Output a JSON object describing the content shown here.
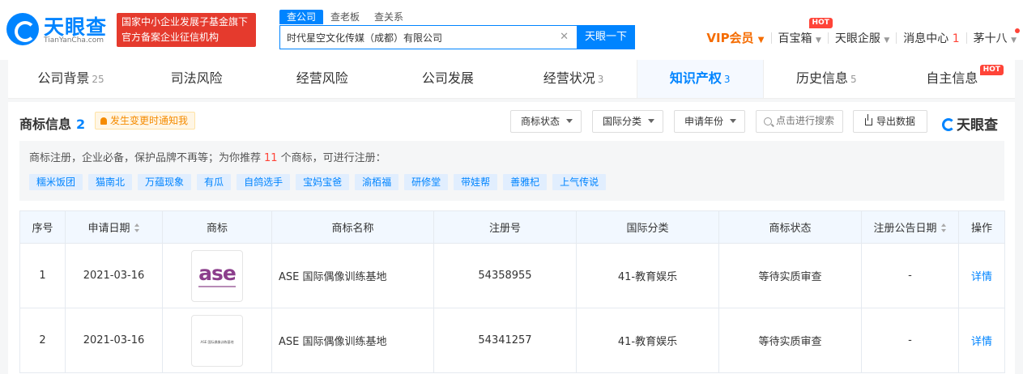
{
  "header": {
    "logo_text": "天眼查",
    "logo_sub": "TianYanCha.com",
    "slogan_line1": "国家中小企业发展子基金旗下",
    "slogan_line2": "官方备案企业征信机构",
    "search_tabs": [
      "查公司",
      "查老板",
      "查关系"
    ],
    "search_value": "时代星空文化传媒（成都）有限公司",
    "search_button": "天眼一下",
    "nav": {
      "vip": "VIP会员",
      "treasure": "百宝箱",
      "hot_badge": "HOT",
      "enterprise": "天眼企服",
      "messages": "消息中心",
      "messages_count": "1",
      "user": "茅十八"
    }
  },
  "tabs": [
    {
      "label": "公司背景",
      "count": "25"
    },
    {
      "label": "司法风险",
      "count": ""
    },
    {
      "label": "经营风险",
      "count": ""
    },
    {
      "label": "公司发展",
      "count": ""
    },
    {
      "label": "经营状况",
      "count": "3"
    },
    {
      "label": "知识产权",
      "count": "3"
    },
    {
      "label": "历史信息",
      "count": "5"
    },
    {
      "label": "自主信息",
      "count": "",
      "badge": "HOT"
    }
  ],
  "panel": {
    "title": "商标信息",
    "count": "2",
    "notify": "发生变更时通知我",
    "filters": [
      "商标状态",
      "国际分类",
      "申请年份"
    ],
    "search_placeholder": "点击进行搜索",
    "export": "导出数据",
    "brand": "天眼查",
    "reco_prefix": "商标注册，企业必备，保护品牌不再等；为你推荐",
    "reco_count": "11",
    "reco_suffix": "个商标，可进行注册：",
    "chips": [
      "糯米饭团",
      "猫南北",
      "万蕴现象",
      "有瓜",
      "自鸽选手",
      "宝妈宝爸",
      "渝栢福",
      "研修堂",
      "带娃帮",
      "善雅杞",
      "上气传说"
    ]
  },
  "table": {
    "headers": [
      "序号",
      "申请日期",
      "商标",
      "商标名称",
      "注册号",
      "国际分类",
      "商标状态",
      "注册公告日期",
      "操作"
    ],
    "rows": [
      {
        "index": "1",
        "date": "2021-03-16",
        "logo_text": "ase",
        "name": "ASE 国际偶像训练基地",
        "reg_no": "54358955",
        "category": "41-教育娱乐",
        "status": "等待实质审查",
        "notice_date": "-",
        "action": "详情"
      },
      {
        "index": "2",
        "date": "2021-03-16",
        "logo_text": "ASE 国际偶像训练基地",
        "name": "ASE 国际偶像训练基地",
        "reg_no": "54341257",
        "category": "41-教育娱乐",
        "status": "等待实质审查",
        "notice_date": "-",
        "action": "详情"
      }
    ]
  }
}
